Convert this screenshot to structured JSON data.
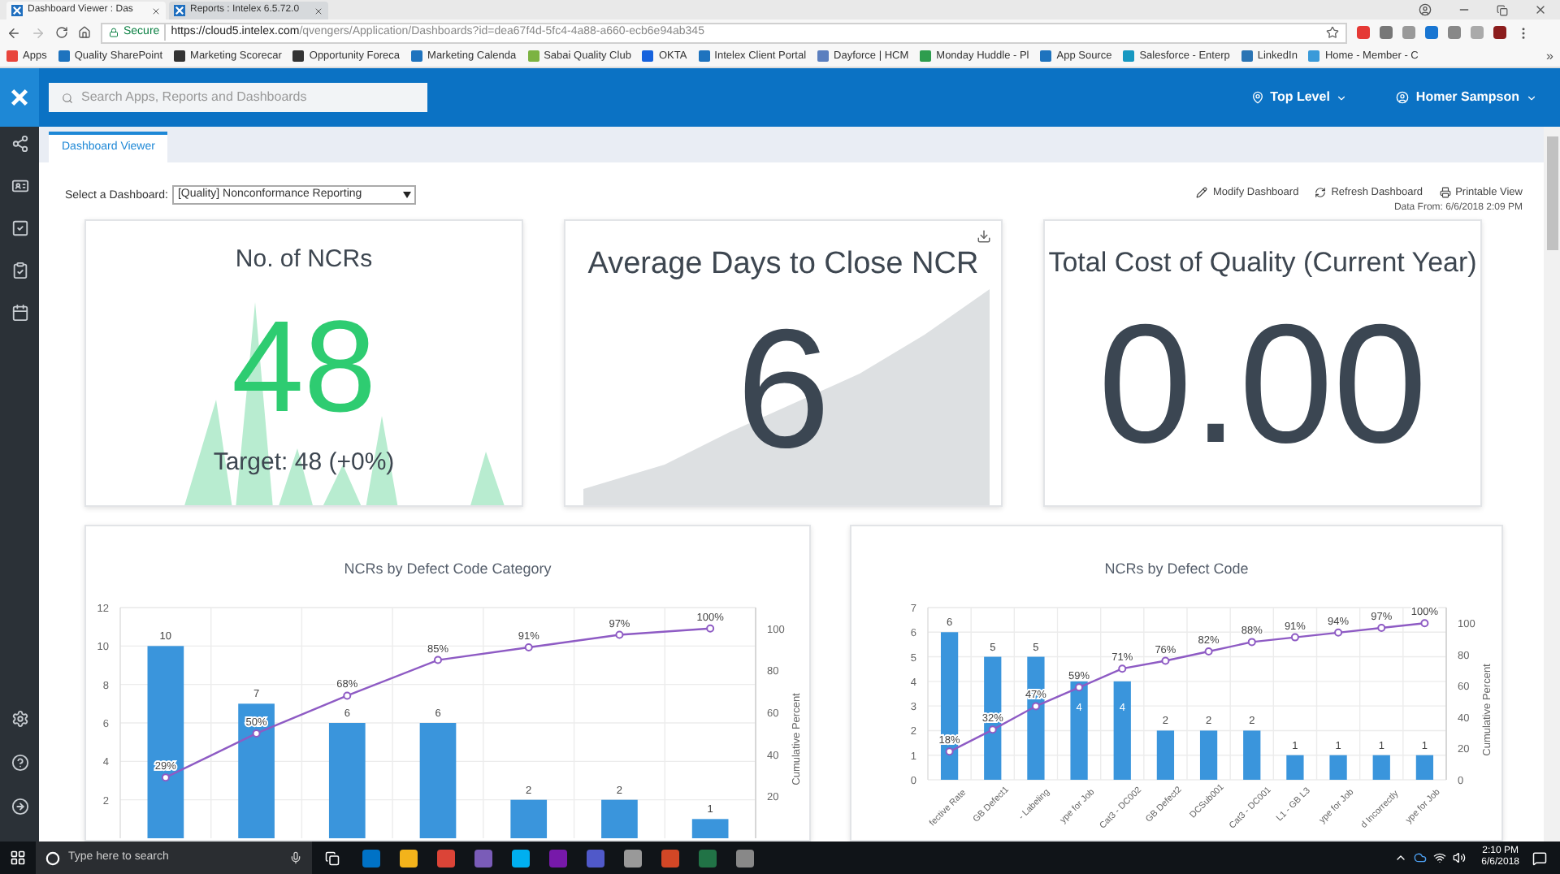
{
  "browser": {
    "tabs": [
      {
        "title": "Dashboard Viewer : Das",
        "selected": true
      },
      {
        "title": "Reports : Intelex 6.5.72.0",
        "selected": false
      }
    ],
    "address": {
      "secure_label": "Secure",
      "url_host": "https://cloud5.intelex.com",
      "url_path": "/qvengers/Application/Dashboards?id=dea67f4d-5fc4-4a88-a660-ecb6e94ab345"
    },
    "bookmarks": [
      {
        "label": "Apps",
        "color": "#e8453c"
      },
      {
        "label": "Quality SharePoint",
        "color": "#1e73be"
      },
      {
        "label": "Marketing Scorecar",
        "color": "#333333"
      },
      {
        "label": "Opportunity Foreca",
        "color": "#333333"
      },
      {
        "label": "Marketing Calenda",
        "color": "#1e73be"
      },
      {
        "label": "Sabai Quality Club",
        "color": "#7cb342"
      },
      {
        "label": "OKTA",
        "color": "#1662dd"
      },
      {
        "label": "Intelex Client Portal",
        "color": "#1e73be"
      },
      {
        "label": "Dayforce | HCM",
        "color": "#5b7fbf"
      },
      {
        "label": "Monday Huddle - Pl",
        "color": "#2e9d4e"
      },
      {
        "label": "App Source",
        "color": "#1e73be"
      },
      {
        "label": "Salesforce - Enterp",
        "color": "#1798c1"
      },
      {
        "label": "LinkedIn",
        "color": "#2a74b4"
      },
      {
        "label": "Home - Member - C",
        "color": "#3a9ad9"
      }
    ],
    "bookmarks_overflow": "»"
  },
  "header": {
    "search": {
      "placeholder": "Search Apps, Reports and Dashboards"
    },
    "location": "Top Level",
    "user": "Homer Sampson"
  },
  "tabs": [
    {
      "label": "Dashboard Viewer",
      "selected": true
    }
  ],
  "toolbar": {
    "select_label": "Select a Dashboard:",
    "select_value": "[Quality] Nonconformance Reporting",
    "actions": [
      {
        "kind": "modify",
        "label": "Modify Dashboard"
      },
      {
        "kind": "refresh",
        "label": "Refresh Dashboard"
      },
      {
        "kind": "print",
        "label": "Printable View"
      }
    ],
    "data_from": "Data From: 6/6/2018 2:09 PM"
  },
  "kpis": [
    {
      "kind": "count",
      "title": "No. of NCRs",
      "value": "48",
      "target": "Target: 48 (+0%)"
    },
    {
      "kind": "days",
      "title": "Average Days to Close NCR",
      "value": "6"
    },
    {
      "kind": "cost",
      "title": "Total Cost of Quality (Current Year)",
      "value": "0.00"
    }
  ],
  "charts": [
    {
      "bars": {
        "chart_data": {
          "type": "bar",
          "title": "NCRs by Defect Code Category",
          "ylim": [
            0,
            12
          ],
          "yticks": [
            2,
            4,
            6,
            8,
            10,
            12
          ],
          "grid": true,
          "data_labels": true,
          "series": [
            {
              "color": "#3a95dc",
              "values": [
                10,
                7,
                6,
                6,
                2,
                2,
                1
              ]
            }
          ]
        }
      },
      "cumulative": {
        "chart_data": {
          "type": "line",
          "ylabel": "Cumulative Percent",
          "ylim": [
            0,
            110
          ],
          "yticks": [
            20,
            40,
            60,
            80,
            100
          ],
          "series": [
            {
              "color": "#8e5bc4",
              "marker": "o",
              "values": [
                29,
                50,
                68,
                85,
                91,
                97,
                100
              ]
            }
          ],
          "value_labels": [
            [
              "29%",
              "50%",
              "68%",
              "85%",
              "91%",
              "97%",
              "100%"
            ]
          ]
        }
      }
    },
    {
      "bars": {
        "chart_data": {
          "type": "bar",
          "title": "NCRs by Defect Code",
          "ylim": [
            0,
            7
          ],
          "yticks": [
            0,
            1,
            2,
            3,
            4,
            5,
            6,
            7
          ],
          "grid": true,
          "data_labels": true,
          "categories": [
            "fective Rate",
            "GB Defect1",
            "- Labeling",
            "ype for Job",
            "Cat3 - DC002",
            "GB Defect2",
            "DCSub001",
            "Cat3 - DC001",
            "L1 - GB L3",
            "ype for Job",
            "d Incorrectly",
            "ype for Job"
          ],
          "series": [
            {
              "color": "#3a95dc",
              "values": [
                6,
                5,
                5,
                4,
                4,
                2,
                2,
                2,
                1,
                1,
                1,
                1
              ]
            }
          ]
        }
      },
      "cumulative": {
        "chart_data": {
          "type": "line",
          "ylabel": "Cumulative Percent",
          "ylim": [
            0,
            110
          ],
          "yticks": [
            0,
            20,
            40,
            60,
            80,
            100
          ],
          "series": [
            {
              "color": "#8e5bc4",
              "marker": "o",
              "values": [
                18,
                32,
                47,
                59,
                71,
                76,
                82,
                88,
                91,
                94,
                97,
                100
              ]
            }
          ],
          "value_labels": [
            [
              "18%",
              "32%",
              "47%",
              "59%",
              "71%",
              "76%",
              "82%",
              "88%",
              "91%",
              "94%",
              "97%",
              "100%"
            ]
          ]
        }
      }
    }
  ],
  "taskbar": {
    "search": {
      "placeholder": "Type here to search"
    },
    "time": "2:10 PM",
    "date": "6/6/2018"
  }
}
